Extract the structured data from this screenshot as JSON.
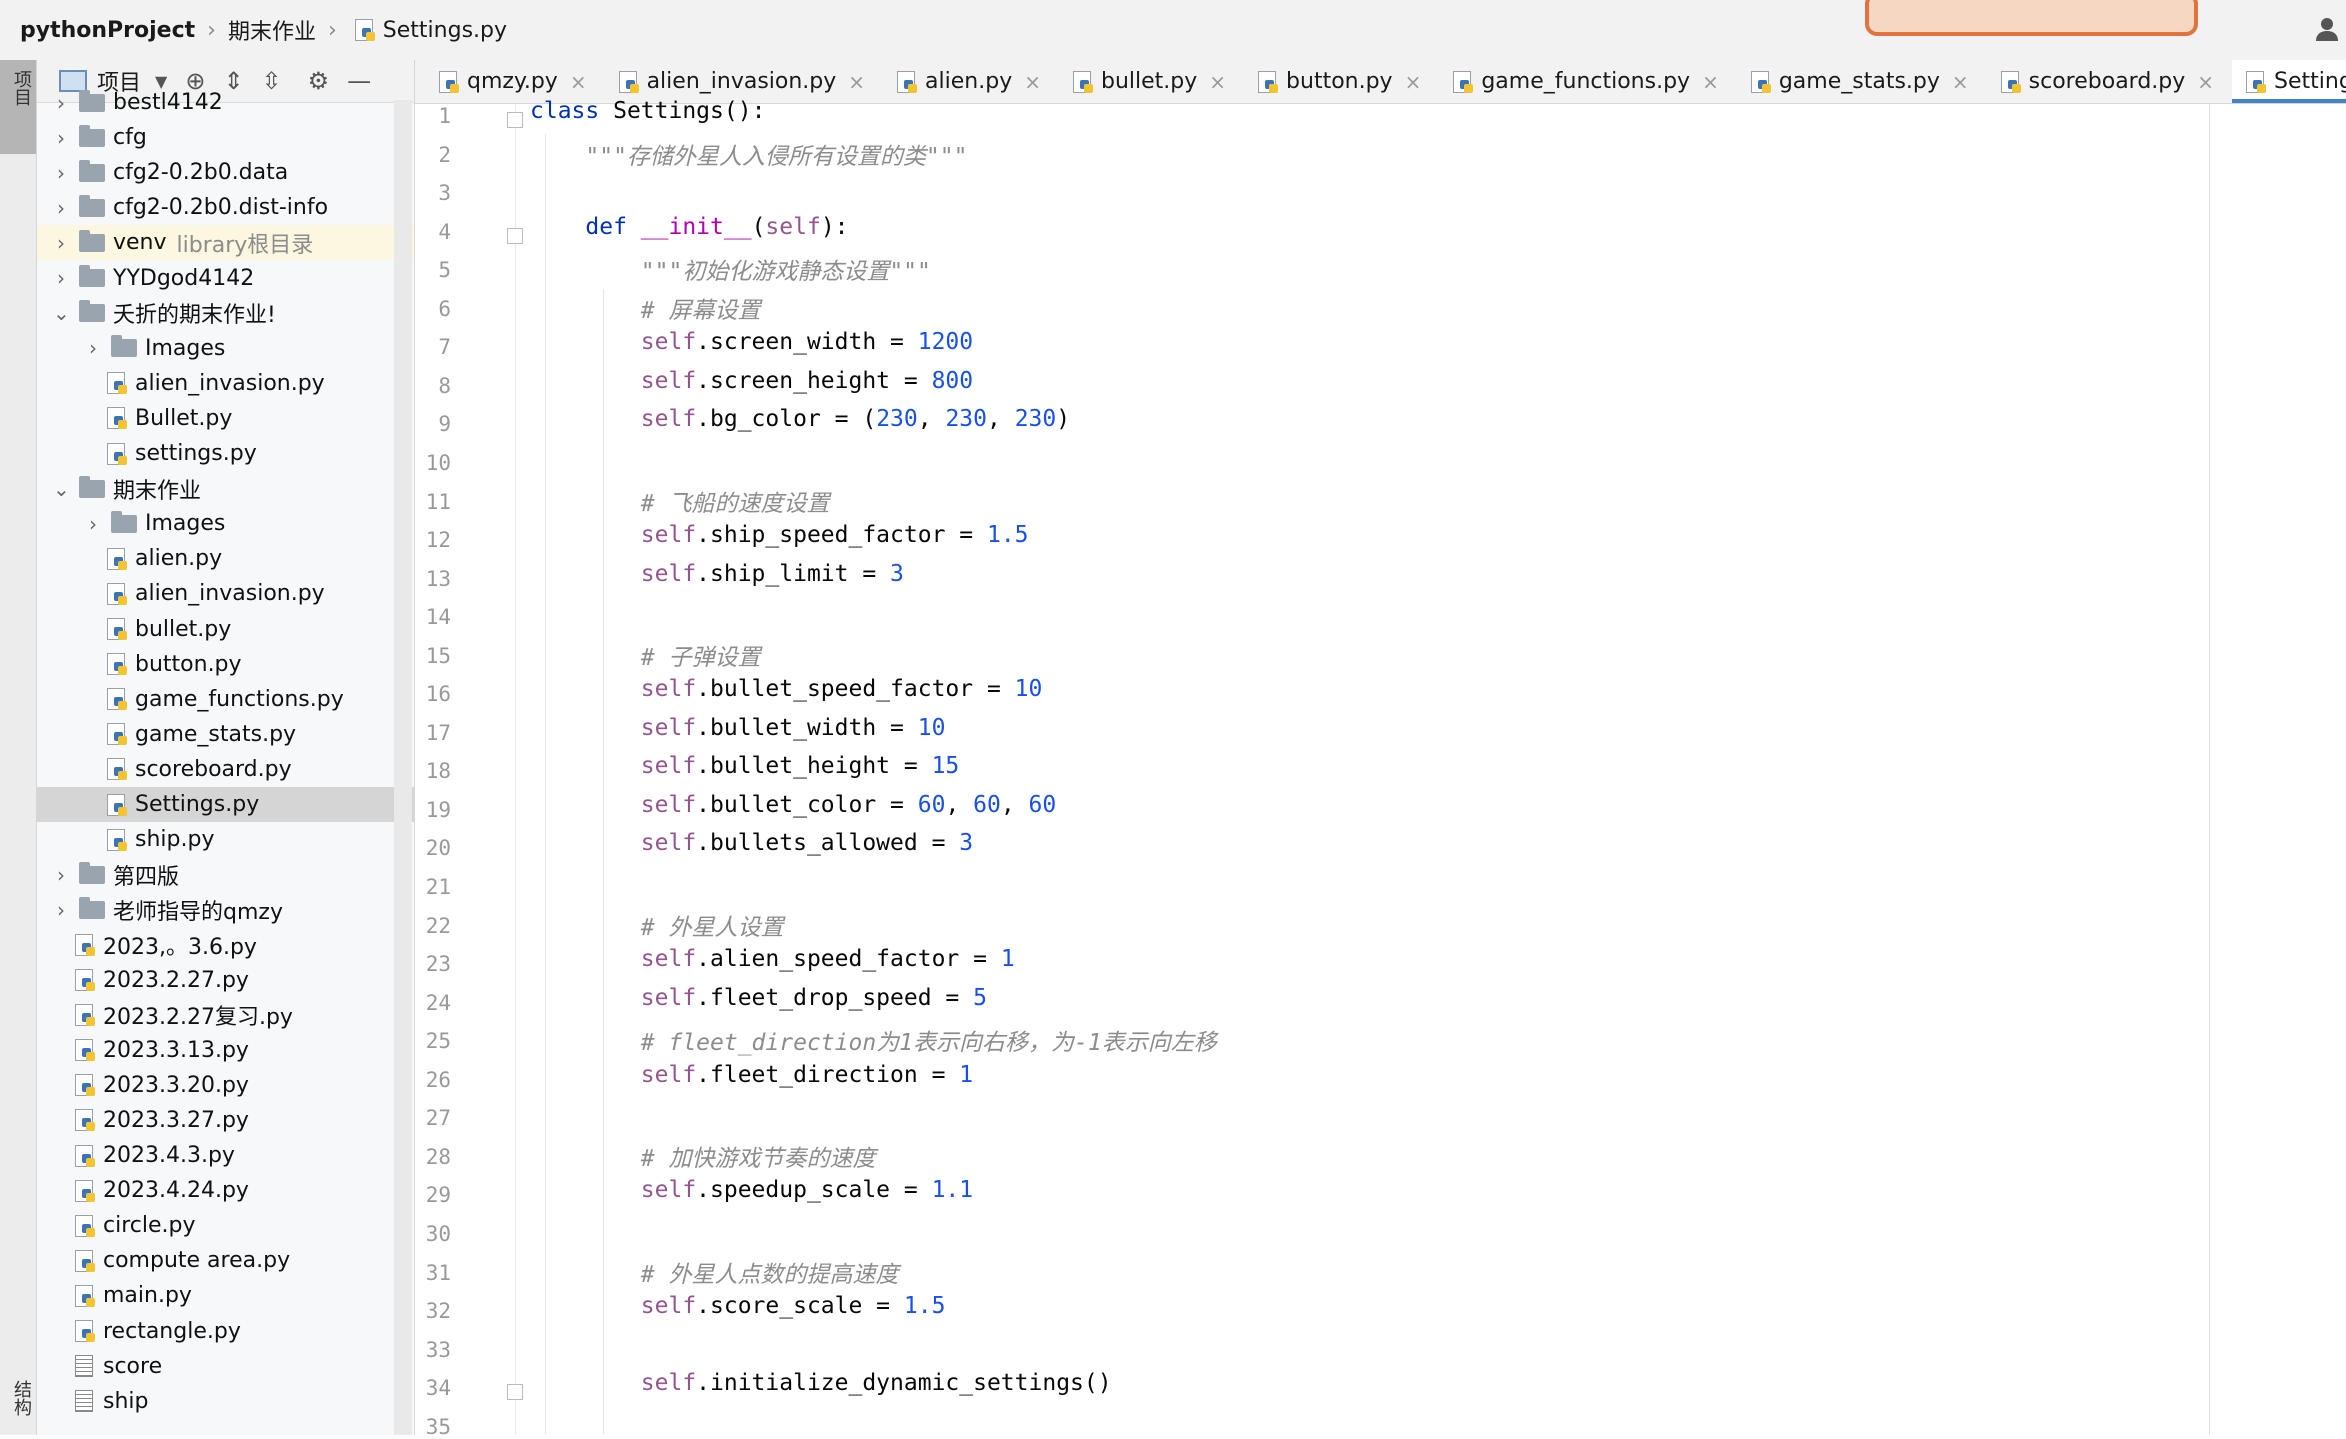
{
  "breadcrumb": {
    "project": "pythonProject",
    "folder": "期末作业",
    "file": "Settings.py"
  },
  "sidebar_stripe": {
    "top_label": "项目",
    "bottom_label": "结构"
  },
  "project_panel": {
    "title": "项目"
  },
  "tree": [
    {
      "label": "bestl4142",
      "type": "folder",
      "level": 1,
      "expanded": false
    },
    {
      "label": "cfg",
      "type": "folder",
      "level": 1,
      "expanded": false
    },
    {
      "label": "cfg2-0.2b0.data",
      "type": "folder",
      "level": 1,
      "expanded": false
    },
    {
      "label": "cfg2-0.2b0.dist-info",
      "type": "folder",
      "level": 1,
      "expanded": false
    },
    {
      "label": "venv",
      "type": "folder",
      "level": 1,
      "expanded": false,
      "suffix": "library根目录"
    },
    {
      "label": "YYDgod4142",
      "type": "folder",
      "level": 1,
      "expanded": false
    },
    {
      "label": "夭折的期末作业!",
      "type": "folder",
      "level": 1,
      "expanded": true
    },
    {
      "label": "Images",
      "type": "folder",
      "level": 2,
      "expanded": false
    },
    {
      "label": "alien_invasion.py",
      "type": "py",
      "level": 2
    },
    {
      "label": "Bullet.py",
      "type": "py",
      "level": 2
    },
    {
      "label": "settings.py",
      "type": "py",
      "level": 2
    },
    {
      "label": "期末作业",
      "type": "folder",
      "level": 1,
      "expanded": true
    },
    {
      "label": "Images",
      "type": "folder",
      "level": 2,
      "expanded": false
    },
    {
      "label": "alien.py",
      "type": "py",
      "level": 2
    },
    {
      "label": "alien_invasion.py",
      "type": "py",
      "level": 2
    },
    {
      "label": "bullet.py",
      "type": "py",
      "level": 2
    },
    {
      "label": "button.py",
      "type": "py",
      "level": 2
    },
    {
      "label": "game_functions.py",
      "type": "py",
      "level": 2
    },
    {
      "label": "game_stats.py",
      "type": "py",
      "level": 2
    },
    {
      "label": "scoreboard.py",
      "type": "py",
      "level": 2
    },
    {
      "label": "Settings.py",
      "type": "py",
      "level": 2,
      "selected": true
    },
    {
      "label": "ship.py",
      "type": "py",
      "level": 2
    },
    {
      "label": "第四版",
      "type": "folder",
      "level": 1,
      "expanded": false
    },
    {
      "label": "老师指导的qmzy",
      "type": "folder",
      "level": 1,
      "expanded": false
    },
    {
      "label": "2023,。3.6.py",
      "type": "py",
      "level": 1
    },
    {
      "label": "2023.2.27.py",
      "type": "py",
      "level": 1
    },
    {
      "label": "2023.2.27复习.py",
      "type": "py",
      "level": 1
    },
    {
      "label": "2023.3.13.py",
      "type": "py",
      "level": 1
    },
    {
      "label": "2023.3.20.py",
      "type": "py",
      "level": 1
    },
    {
      "label": "2023.3.27.py",
      "type": "py",
      "level": 1
    },
    {
      "label": "2023.4.3.py",
      "type": "py",
      "level": 1
    },
    {
      "label": "2023.4.24.py",
      "type": "py",
      "level": 1
    },
    {
      "label": "circle.py",
      "type": "py",
      "level": 1
    },
    {
      "label": "compute area.py",
      "type": "py",
      "level": 1
    },
    {
      "label": "main.py",
      "type": "py",
      "level": 1
    },
    {
      "label": "rectangle.py",
      "type": "py",
      "level": 1
    },
    {
      "label": "score",
      "type": "txt",
      "level": 1
    },
    {
      "label": "ship",
      "type": "txt",
      "level": 1
    }
  ],
  "tabs": [
    {
      "label": "qmzy.py"
    },
    {
      "label": "alien_invasion.py"
    },
    {
      "label": "alien.py"
    },
    {
      "label": "bullet.py"
    },
    {
      "label": "button.py"
    },
    {
      "label": "game_functions.py"
    },
    {
      "label": "game_stats.py"
    },
    {
      "label": "scoreboard.py"
    },
    {
      "label": "Settings.py",
      "active": true
    }
  ],
  "code_lines": [
    [
      [
        "kw",
        "class "
      ],
      [
        "p",
        "Settings():"
      ]
    ],
    [
      [
        "p",
        "    "
      ],
      [
        "doc",
        "\"\"\"存储外星人入侵所有设置的类\"\"\""
      ]
    ],
    [],
    [
      [
        "p",
        "    "
      ],
      [
        "kw",
        "def "
      ],
      [
        "fn",
        "__init__"
      ],
      [
        "p",
        "("
      ],
      [
        "selfk",
        "self"
      ],
      [
        "p",
        "):"
      ]
    ],
    [
      [
        "p",
        "        "
      ],
      [
        "doc",
        "\"\"\"初始化游戏静态设置\"\"\""
      ]
    ],
    [
      [
        "p",
        "        "
      ],
      [
        "cmt",
        "# 屏幕设置"
      ]
    ],
    [
      [
        "p",
        "        "
      ],
      [
        "selfk",
        "self"
      ],
      [
        "p",
        ".screen_width = "
      ],
      [
        "num",
        "1200"
      ]
    ],
    [
      [
        "p",
        "        "
      ],
      [
        "selfk",
        "self"
      ],
      [
        "p",
        ".screen_height = "
      ],
      [
        "num",
        "800"
      ]
    ],
    [
      [
        "p",
        "        "
      ],
      [
        "selfk",
        "self"
      ],
      [
        "p",
        ".bg_color = ("
      ],
      [
        "num",
        "230"
      ],
      [
        "p",
        ", "
      ],
      [
        "num",
        "230"
      ],
      [
        "p",
        ", "
      ],
      [
        "num",
        "230"
      ],
      [
        "p",
        ")"
      ]
    ],
    [],
    [
      [
        "p",
        "        "
      ],
      [
        "cmt",
        "# 飞船的速度设置"
      ]
    ],
    [
      [
        "p",
        "        "
      ],
      [
        "selfk",
        "self"
      ],
      [
        "p",
        ".ship_speed_factor = "
      ],
      [
        "num",
        "1.5"
      ]
    ],
    [
      [
        "p",
        "        "
      ],
      [
        "selfk",
        "self"
      ],
      [
        "p",
        ".ship_limit = "
      ],
      [
        "num",
        "3"
      ]
    ],
    [],
    [
      [
        "p",
        "        "
      ],
      [
        "cmt",
        "# 子弹设置"
      ]
    ],
    [
      [
        "p",
        "        "
      ],
      [
        "selfk",
        "self"
      ],
      [
        "p",
        ".bullet_speed_factor = "
      ],
      [
        "num",
        "10"
      ]
    ],
    [
      [
        "p",
        "        "
      ],
      [
        "selfk",
        "self"
      ],
      [
        "p",
        ".bullet_width = "
      ],
      [
        "num",
        "10"
      ]
    ],
    [
      [
        "p",
        "        "
      ],
      [
        "selfk",
        "self"
      ],
      [
        "p",
        ".bullet_height = "
      ],
      [
        "num",
        "15"
      ]
    ],
    [
      [
        "p",
        "        "
      ],
      [
        "selfk",
        "self"
      ],
      [
        "p",
        ".bullet_color = "
      ],
      [
        "num",
        "60"
      ],
      [
        "p",
        ", "
      ],
      [
        "num",
        "60"
      ],
      [
        "p",
        ", "
      ],
      [
        "num",
        "60"
      ]
    ],
    [
      [
        "p",
        "        "
      ],
      [
        "selfk",
        "self"
      ],
      [
        "p",
        ".bullets_allowed = "
      ],
      [
        "num",
        "3"
      ]
    ],
    [],
    [
      [
        "p",
        "        "
      ],
      [
        "cmt",
        "# 外星人设置"
      ]
    ],
    [
      [
        "p",
        "        "
      ],
      [
        "selfk",
        "self"
      ],
      [
        "p",
        ".alien_speed_factor = "
      ],
      [
        "num",
        "1"
      ]
    ],
    [
      [
        "p",
        "        "
      ],
      [
        "selfk",
        "self"
      ],
      [
        "p",
        ".fleet_drop_speed = "
      ],
      [
        "num",
        "5"
      ]
    ],
    [
      [
        "p",
        "        "
      ],
      [
        "cmt",
        "# fleet_direction为1表示向右移，为-1表示向左移"
      ]
    ],
    [
      [
        "p",
        "        "
      ],
      [
        "selfk",
        "self"
      ],
      [
        "p",
        ".fleet_direction = "
      ],
      [
        "num",
        "1"
      ]
    ],
    [],
    [
      [
        "p",
        "        "
      ],
      [
        "cmt",
        "# 加快游戏节奏的速度"
      ]
    ],
    [
      [
        "p",
        "        "
      ],
      [
        "selfk",
        "self"
      ],
      [
        "p",
        ".speedup_scale = "
      ],
      [
        "num",
        "1.1"
      ]
    ],
    [],
    [
      [
        "p",
        "        "
      ],
      [
        "cmt",
        "# 外星人点数的提高速度"
      ]
    ],
    [
      [
        "p",
        "        "
      ],
      [
        "selfk",
        "self"
      ],
      [
        "p",
        ".score_scale = "
      ],
      [
        "num",
        "1.5"
      ]
    ],
    [],
    [
      [
        "p",
        "        "
      ],
      [
        "selfk",
        "self"
      ],
      [
        "p",
        ".initialize_dynamic_settings()"
      ]
    ],
    []
  ],
  "line_numbers": [
    "1",
    "2",
    "3",
    "4",
    "5",
    "6",
    "7",
    "8",
    "9",
    "10",
    "11",
    "12",
    "13",
    "14",
    "15",
    "16",
    "17",
    "18",
    "19",
    "20",
    "21",
    "22",
    "23",
    "24",
    "25",
    "26",
    "27",
    "28",
    "29",
    "30",
    "31",
    "32",
    "33",
    "34",
    "35"
  ]
}
